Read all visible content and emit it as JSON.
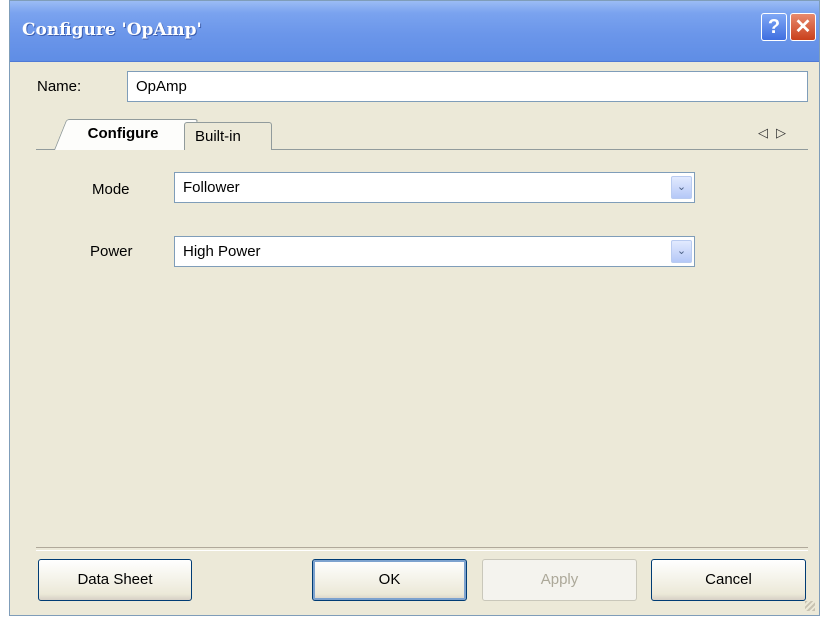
{
  "window": {
    "title": "Configure 'OpAmp'",
    "help_glyph": "?",
    "close_glyph": "✕"
  },
  "name_field": {
    "label": "Name:",
    "value": "OpAmp"
  },
  "tabs": [
    {
      "label": "Configure",
      "selected": true
    },
    {
      "label": "Built-in",
      "selected": false
    }
  ],
  "tab_scroll": {
    "left": "◁",
    "right": "▷"
  },
  "configure": {
    "mode": {
      "label": "Mode",
      "value": "Follower"
    },
    "power": {
      "label": "Power",
      "value": "High Power"
    }
  },
  "dropdown_glyph": "⌄",
  "buttons": {
    "data_sheet": "Data Sheet",
    "ok": "OK",
    "apply": "Apply",
    "cancel": "Cancel"
  },
  "colors": {
    "titlebar": "#6b96ea",
    "window_bg": "#ece9d8",
    "border": "#7f9db9",
    "close": "#c9401c"
  }
}
